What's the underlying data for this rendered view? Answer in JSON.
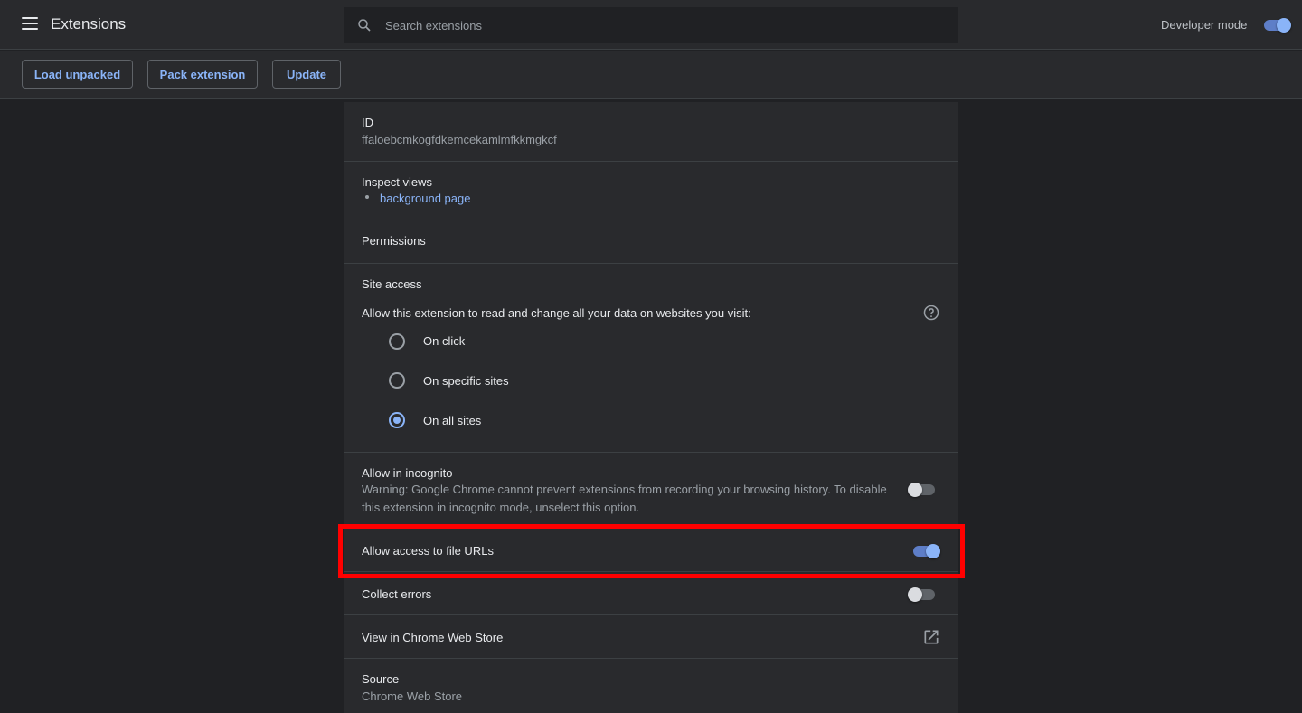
{
  "header": {
    "title": "Extensions",
    "search_placeholder": "Search extensions",
    "developer_mode_label": "Developer mode",
    "developer_mode_on": true
  },
  "toolbar": {
    "load_unpacked": "Load unpacked",
    "pack_extension": "Pack extension",
    "update": "Update"
  },
  "details": {
    "id_label": "ID",
    "id_value": "ffaloebcmkogfdkemcekamlmfkkmgkcf",
    "inspect_views_label": "Inspect views",
    "inspect_views_link": "background page",
    "permissions_label": "Permissions",
    "site_access_label": "Site access",
    "site_access_prompt": "Allow this extension to read and change all your data on websites you visit:",
    "site_access_options": [
      "On click",
      "On specific sites",
      "On all sites"
    ],
    "site_access_selected": "On all sites",
    "incognito_label": "Allow in incognito",
    "incognito_warning_line1": "Warning: Google Chrome cannot prevent extensions from recording your browsing history. To disable",
    "incognito_warning_line2": "this extension in incognito mode, unselect this option.",
    "incognito_on": false,
    "file_urls_label": "Allow access to file URLs",
    "file_urls_on": true,
    "collect_errors_label": "Collect errors",
    "collect_errors_on": false,
    "web_store_label": "View in Chrome Web Store",
    "source_label": "Source",
    "source_value": "Chrome Web Store"
  },
  "colors": {
    "accent": "#8ab4f8",
    "highlight": "#ff0000"
  }
}
